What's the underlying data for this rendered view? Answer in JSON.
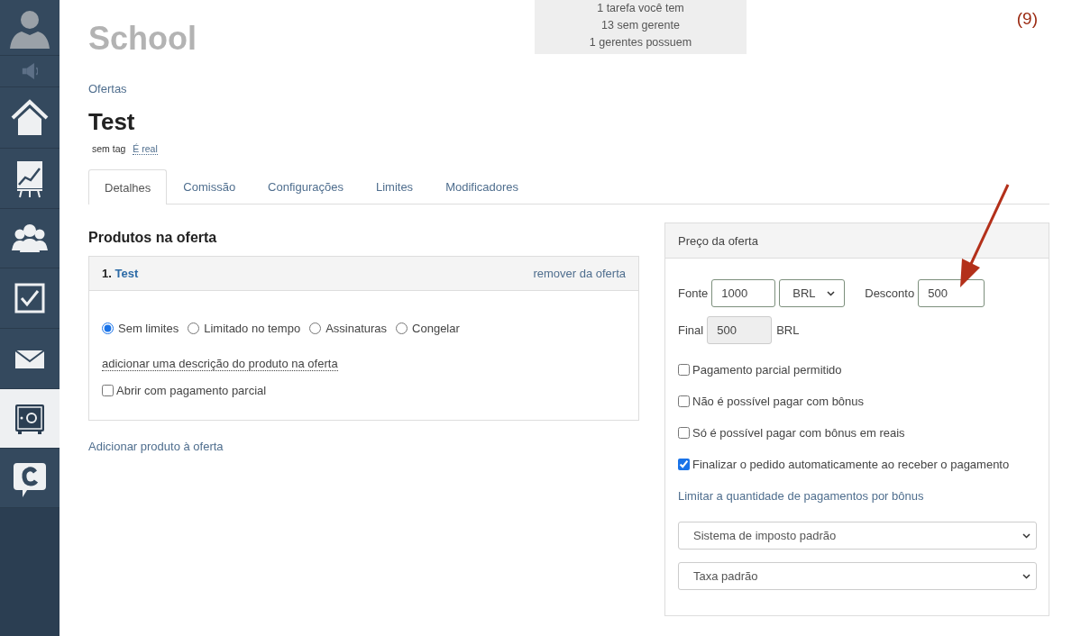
{
  "sidebar": {
    "items": [
      {
        "kind": "avatar",
        "selected": false
      },
      {
        "kind": "speaker",
        "selected": false
      },
      {
        "kind": "home",
        "selected": false
      },
      {
        "kind": "chart",
        "selected": false
      },
      {
        "kind": "users",
        "selected": false
      },
      {
        "kind": "check",
        "selected": false
      },
      {
        "kind": "mail",
        "selected": false
      },
      {
        "kind": "safe",
        "selected": true
      },
      {
        "kind": "chat",
        "selected": false
      }
    ]
  },
  "header": {
    "title": "School",
    "notice": [
      "1 tarefa você tem",
      "13 sem gerente",
      "1 gerentes possuem"
    ],
    "counter": "(9)"
  },
  "breadcrumb": "Ofertas",
  "page_title": "Test",
  "tags": [
    "sem tag",
    "É real"
  ],
  "tabs": [
    {
      "label": "Detalhes",
      "selected": true
    },
    {
      "label": "Comissão",
      "selected": false
    },
    {
      "label": "Configurações",
      "selected": false
    },
    {
      "label": "Limites",
      "selected": false
    },
    {
      "label": "Modificadores",
      "selected": false
    }
  ],
  "products": {
    "heading": "Produtos na oferta",
    "items": [
      {
        "number": "1.",
        "name": "Test",
        "remove": "remover da oferta",
        "options": [
          {
            "label": "Sem limites",
            "selected": true
          },
          {
            "label": "Limitado no tempo",
            "selected": false
          },
          {
            "label": "Assinaturas",
            "selected": false
          },
          {
            "label": "Congelar",
            "selected": false
          }
        ],
        "description_link": "adicionar uma descrição do produto na oferta",
        "partial": {
          "label": "Abrir com pagamento parcial",
          "checked": false
        }
      }
    ],
    "add_link": "Adicionar produto à oferta"
  },
  "price": {
    "title": "Preço da oferta",
    "source_label": "Fonte",
    "source_value": "1000",
    "currency": "BRL",
    "discount_label": "Desconto",
    "discount_value": "500",
    "final_label": "Final",
    "final_value": "500",
    "final_currency": "BRL",
    "checks": [
      {
        "label": "Pagamento parcial permitido",
        "checked": false
      },
      {
        "label": "Não é possível pagar com bônus",
        "checked": false
      },
      {
        "label": "Só é possível pagar com bônus em reais",
        "checked": false
      },
      {
        "label": "Finalizar o pedido automaticamente ao receber o pagamento",
        "checked": true
      }
    ],
    "limit_link": "Limitar a quantidade de pagamentos por bônus",
    "selects": [
      "Sistema de imposto padrão",
      "Taxa padrão"
    ]
  }
}
